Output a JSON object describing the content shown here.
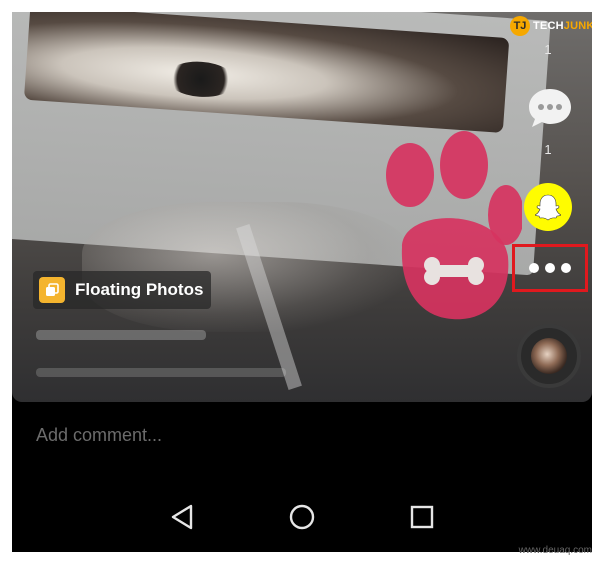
{
  "branding": {
    "logo_mark": "TJ",
    "logo_part1": "TECH",
    "logo_part2": "JUNKIE"
  },
  "effect": {
    "label": "Floating Photos",
    "icon": "floating-photos-icon"
  },
  "actions": {
    "like_count": "1",
    "comment_count": "1",
    "more_dots": "more-dots-icon",
    "share_icon": "snapchat-ghost-icon"
  },
  "comment": {
    "placeholder": "Add comment..."
  },
  "watermark": "www.deuaq.com",
  "colors": {
    "snap_yellow": "#fffc00",
    "highlight_red": "#e0191e",
    "paw_pink": "#d6335f",
    "accent_orange": "#f4b42e"
  }
}
